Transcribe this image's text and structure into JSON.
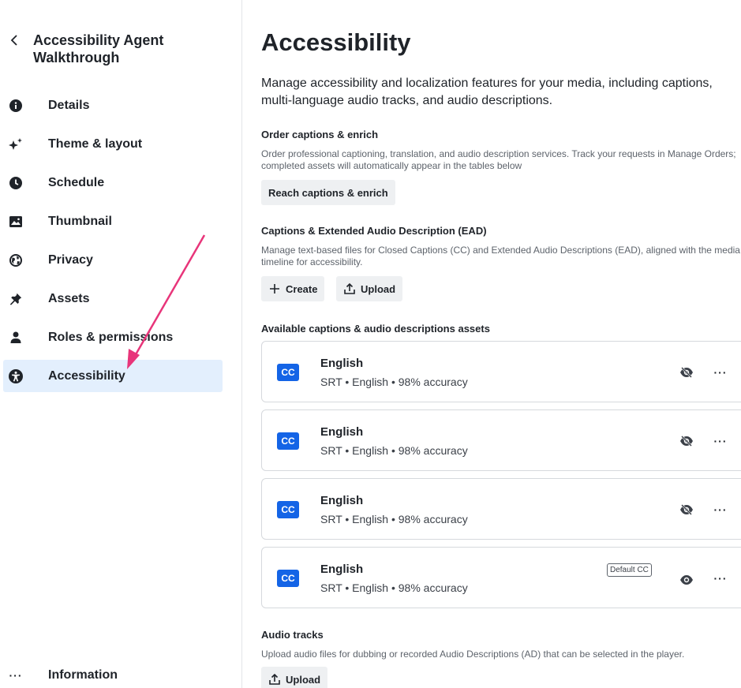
{
  "sidebar": {
    "title": "Accessibility Agent Walkthrough",
    "items": [
      {
        "label": "Details",
        "icon": "info-icon"
      },
      {
        "label": "Theme & layout",
        "icon": "sparkle-icon"
      },
      {
        "label": "Schedule",
        "icon": "clock-icon"
      },
      {
        "label": "Thumbnail",
        "icon": "image-icon"
      },
      {
        "label": "Privacy",
        "icon": "globe-icon"
      },
      {
        "label": "Assets",
        "icon": "pin-icon"
      },
      {
        "label": "Roles & permissions",
        "icon": "person-icon"
      },
      {
        "label": "Accessibility",
        "icon": "accessibility-icon",
        "active": true
      }
    ],
    "footer_label": "Information",
    "footer_icon": "more-icon"
  },
  "main": {
    "title": "Accessibility",
    "intro": "Manage accessibility and localization features for your media, including captions, multi-language audio tracks, and audio descriptions.",
    "order": {
      "title": "Order captions & enrich",
      "desc": "Order professional captioning, translation, and audio description services. Track your requests in Manage Orders; completed assets will automatically appear in the tables below",
      "button": "Reach captions & enrich"
    },
    "captions": {
      "title": "Captions & Extended Audio Description (EAD)",
      "desc": "Manage text-based files for Closed Captions (CC) and Extended Audio Descriptions (EAD), aligned with the media timeline for accessibility.",
      "create_label": "Create",
      "upload_label": "Upload"
    },
    "available": {
      "title": "Available captions & audio descriptions assets",
      "badge": "CC",
      "assets": [
        {
          "name": "English",
          "meta": "SRT • English • 98% accuracy",
          "visible": false,
          "default": ""
        },
        {
          "name": "English",
          "meta": "SRT • English • 98% accuracy",
          "visible": false,
          "default": ""
        },
        {
          "name": "English",
          "meta": "SRT • English • 98% accuracy",
          "visible": false,
          "default": ""
        },
        {
          "name": "English",
          "meta": "SRT • English • 98% accuracy",
          "visible": true,
          "default": "Default CC"
        }
      ]
    },
    "audio": {
      "title": "Audio tracks",
      "desc": "Upload audio files for dubbing or recorded Audio Descriptions (AD) that can be selected in the player.",
      "upload_label": "Upload"
    }
  },
  "colors": {
    "accent": "#1464e6",
    "active_bg": "#e3effd",
    "annotation_arrow": "#e8357a"
  }
}
